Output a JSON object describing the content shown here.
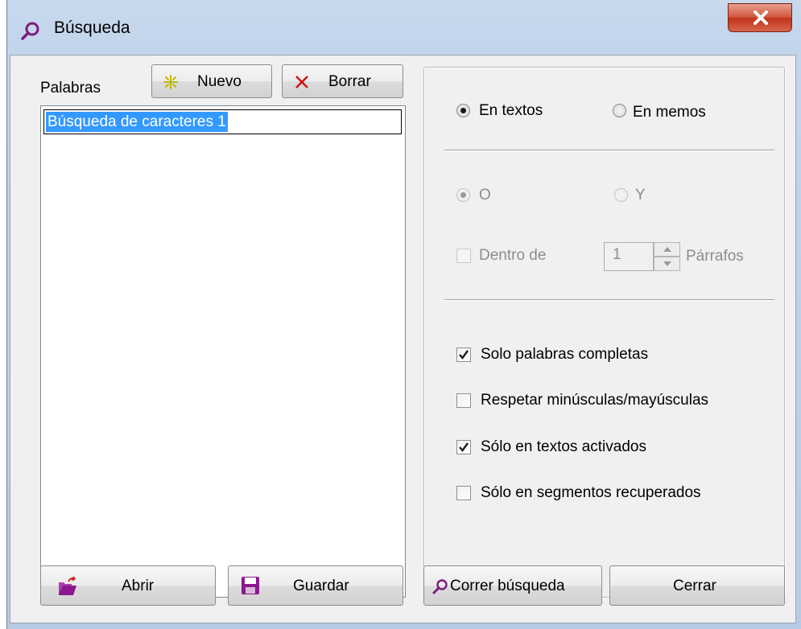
{
  "window": {
    "title": "Búsqueda"
  },
  "words": {
    "label": "Palabras",
    "new_label": "Nuevo",
    "delete_label": "Borrar",
    "items": [
      "Búsqueda de caracteres 1"
    ]
  },
  "scope": {
    "in_texts_label": "En textos",
    "in_memos_label": "En memos",
    "selected": "En textos"
  },
  "logic": {
    "or_label": "O",
    "and_label": "Y",
    "selected": "O",
    "within_label": "Dentro de",
    "within_value": "1",
    "paragraphs_label": "Párrafos",
    "within_checked": false
  },
  "options": [
    {
      "label": "Solo palabras completas",
      "checked": true
    },
    {
      "label": "Respetar minúsculas/mayúsculas",
      "checked": false
    },
    {
      "label": "Sólo en textos activados",
      "checked": true
    },
    {
      "label": "Sólo en segmentos recuperados",
      "checked": false
    }
  ],
  "footer": {
    "open_label": "Abrir",
    "save_label": "Guardar",
    "run_label": "Correr búsqueda",
    "close_label": "Cerrar"
  },
  "icons": {
    "title": "magnifier-icon",
    "new": "sparkle-icon",
    "delete": "x-icon",
    "open": "open-folder-icon",
    "save": "floppy-disk-icon",
    "run": "magnifier-icon"
  },
  "colors": {
    "selection": "#3399ff",
    "magnifier": "#7b1c7d",
    "delete_x": "#d01010",
    "close_button": "#c8452b"
  }
}
